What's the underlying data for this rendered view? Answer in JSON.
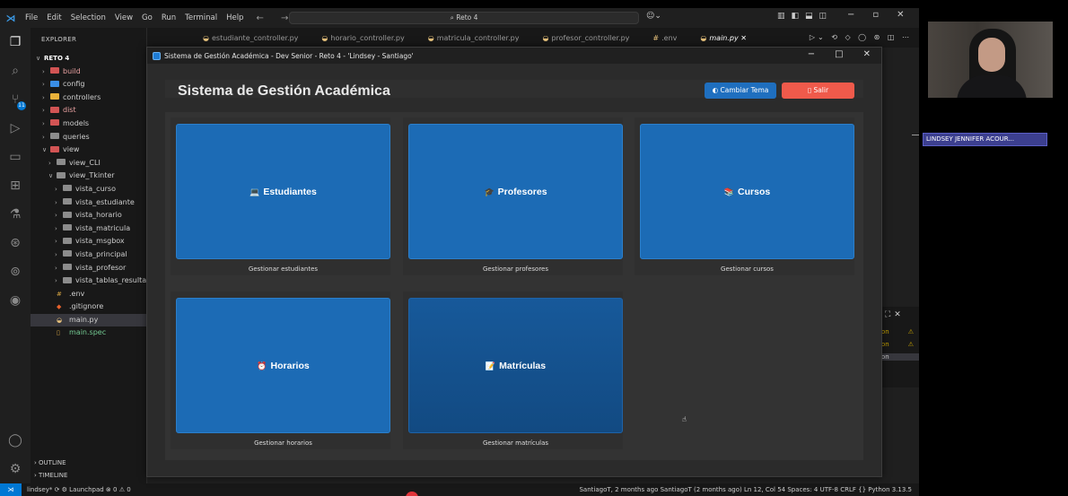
{
  "vscode": {
    "menu": [
      "File",
      "Edit",
      "Selection",
      "View",
      "Go",
      "Run",
      "Terminal",
      "Help"
    ],
    "search_text": "Reto 4",
    "sidebar_title": "EXPLORER",
    "tree": [
      {
        "label": "RETO 4",
        "indent": 0,
        "chev": "∨",
        "color": "#ffffff",
        "bold": true
      },
      {
        "label": "build",
        "indent": 1,
        "chev": "›",
        "color": "#e8a0a0",
        "icon": "#d25454"
      },
      {
        "label": "config",
        "indent": 1,
        "chev": "›",
        "color": "#cccccc",
        "icon": "#3a8ee6"
      },
      {
        "label": "controllers",
        "indent": 1,
        "chev": "›",
        "color": "#cccccc",
        "icon": "#e8b13a"
      },
      {
        "label": "dist",
        "indent": 1,
        "chev": "›",
        "color": "#e8a0a0",
        "icon": "#d25454"
      },
      {
        "label": "models",
        "indent": 1,
        "chev": "›",
        "color": "#cccccc",
        "icon": "#d25454"
      },
      {
        "label": "queries",
        "indent": 1,
        "chev": "›",
        "color": "#cccccc",
        "icon": "#8c8c8c"
      },
      {
        "label": "view",
        "indent": 1,
        "chev": "∨",
        "color": "#cccccc",
        "icon": "#d25454"
      },
      {
        "label": "view_CLI",
        "indent": 2,
        "chev": "›",
        "color": "#cccccc",
        "icon": "#8c8c8c"
      },
      {
        "label": "view_Tkinter",
        "indent": 2,
        "chev": "∨",
        "color": "#cccccc",
        "icon": "#8c8c8c"
      },
      {
        "label": "vista_curso",
        "indent": 3,
        "chev": "›",
        "color": "#cccccc",
        "icon": "#8c8c8c"
      },
      {
        "label": "vista_estudiante",
        "indent": 3,
        "chev": "›",
        "color": "#cccccc",
        "icon": "#8c8c8c"
      },
      {
        "label": "vista_horario",
        "indent": 3,
        "chev": "›",
        "color": "#cccccc",
        "icon": "#8c8c8c"
      },
      {
        "label": "vista_matricula",
        "indent": 3,
        "chev": "›",
        "color": "#cccccc",
        "icon": "#8c8c8c"
      },
      {
        "label": "vista_msgbox",
        "indent": 3,
        "chev": "›",
        "color": "#cccccc",
        "icon": "#8c8c8c"
      },
      {
        "label": "vista_principal",
        "indent": 3,
        "chev": "›",
        "color": "#cccccc",
        "icon": "#8c8c8c"
      },
      {
        "label": "vista_profesor",
        "indent": 3,
        "chev": "›",
        "color": "#cccccc",
        "icon": "#8c8c8c"
      },
      {
        "label": "vista_tablas_resultados",
        "indent": 3,
        "chev": "›",
        "color": "#cccccc",
        "icon": "#8c8c8c"
      },
      {
        "label": ".env",
        "indent": 2,
        "chev": "",
        "color": "#cccccc",
        "glyph": "#"
      },
      {
        "label": ".gitignore",
        "indent": 2,
        "chev": "",
        "color": "#cccccc",
        "glyph": "◆"
      },
      {
        "label": "main.py",
        "indent": 2,
        "chev": "",
        "color": "#cccccc",
        "glyph": "py",
        "selected": true
      },
      {
        "label": "main.spec",
        "indent": 2,
        "chev": "",
        "color": "#73c991",
        "glyph": "▯"
      }
    ],
    "outline_label": "OUTLINE",
    "timeline_label": "TIMELINE",
    "tabs": [
      {
        "label": "estudiante_controller.py",
        "active": false
      },
      {
        "label": "horario_controller.py",
        "active": false
      },
      {
        "label": "matricula_controller.py",
        "active": false
      },
      {
        "label": "profesor_controller.py",
        "active": false
      },
      {
        "label": ".env",
        "active": false
      },
      {
        "label": "main.py",
        "active": true
      }
    ],
    "right_panel_rows": [
      "on",
      "on",
      "on"
    ],
    "status_left": "lindsey*   ⟳   ⚙   Launchpad   ⊗ 0 ⚠ 0",
    "status_right": "SantiagoT, 2 months ago    SantiagoT (2 months ago)   Ln 12, Col 54   Spaces: 4   UTF-8   CRLF   {} Python   3.13.5"
  },
  "app": {
    "window_title": "Sistema de Gestión Académica - Dev Senior - Reto 4 - 'Lindsey - Santiago'",
    "title": "Sistema de Gestión Académica",
    "btn_theme": "Cambiar Tema",
    "btn_exit": "Salir",
    "cards": [
      {
        "label": "Estudiantes",
        "desc": "Gestionar estudiantes",
        "icon": "💻"
      },
      {
        "label": "Profesores",
        "desc": "Gestionar profesores",
        "icon": "🎓"
      },
      {
        "label": "Cursos",
        "desc": "Gestionar cursos",
        "icon": "📚"
      },
      {
        "label": "Horarios",
        "desc": "Gestionar horarios",
        "icon": "⏰"
      },
      {
        "label": "Matrículas",
        "desc": "Gestionar matrículas",
        "icon": "📝"
      }
    ]
  },
  "meeting": {
    "participant_name": "LINDSEY JENNIFER ACOUR..."
  }
}
